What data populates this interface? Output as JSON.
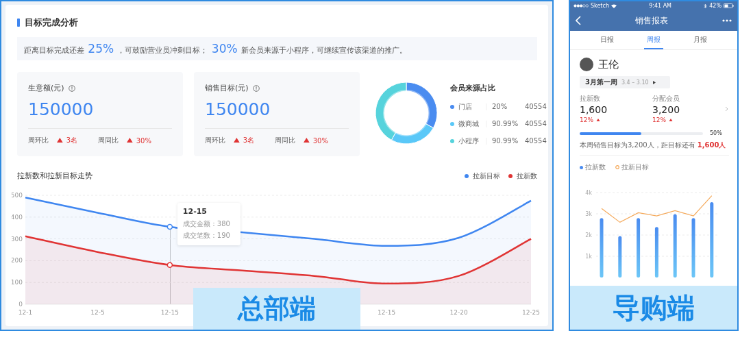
{
  "dashboard": {
    "title": "目标完成分析",
    "summary": "距离目标完成还差 **25%** ，可鼓励营业员冲刺目标； **30%** 新会员来源于小程序，可继续宣传该渠道的推广。",
    "metrics": [
      {
        "label": "生意额(元)",
        "value": "150000",
        "comparisons": [
          {
            "label": "周环比",
            "change": "3名"
          },
          {
            "label": "周同比",
            "change": "30%"
          }
        ]
      },
      {
        "label": "销售目标(元)",
        "value": "150000",
        "comparisons": [
          {
            "label": "周环比",
            "change": "3名"
          },
          {
            "label": "周同比",
            "change": "30%"
          }
        ]
      }
    ],
    "member_sources": {
      "title": "会员来源占比",
      "items": [
        {
          "name": "门店",
          "percent": "20%",
          "count": "40554",
          "color": "#4a8cf0"
        },
        {
          "name": "微商城",
          "percent": "90.99%",
          "count": "40554",
          "color": "#5ac8f8"
        },
        {
          "name": "小程序",
          "percent": "90.99%",
          "count": "40554",
          "color": "#56d3dc"
        }
      ]
    },
    "trend": {
      "title": "拉新数和拉新目标走势",
      "tooltip": {
        "title": "12-15",
        "lines": [
          "成交金额：380",
          "成交笔数：190"
        ]
      },
      "chart_data": {
        "type": "area",
        "grid": true,
        "categories": [
          "12-1",
          "12-5",
          "12-15",
          null,
          null,
          "12-15",
          "12-20",
          "12-25"
        ],
        "ylim": [
          0,
          500
        ],
        "yticks": [
          0,
          100,
          200,
          300,
          400,
          500
        ],
        "series": [
          {
            "name": "拉新目标",
            "color": "#3f86f0",
            "values": [
              490,
              420,
              355,
              330,
              300,
              268,
              305,
              475
            ]
          },
          {
            "name": "拉新数",
            "color": "#e03434",
            "values": [
              312,
              240,
              180,
              155,
              130,
              95,
              130,
              300
            ]
          }
        ]
      }
    },
    "badge": "总部端"
  },
  "phone": {
    "status_bar": {
      "carrier": "Sketch",
      "time": "9:41 AM",
      "battery": "42%"
    },
    "nav_title": "销售报表",
    "tabs": [
      {
        "label": "日报",
        "selected": false
      },
      {
        "label": "周报",
        "selected": true
      },
      {
        "label": "月报",
        "selected": false
      }
    ],
    "user_name": "王伦",
    "period": {
      "label": "3月第一周",
      "range": "3.4 – 3.10"
    },
    "stats": [
      {
        "label": "拉新数",
        "value": "1,600",
        "change": "12%"
      },
      {
        "label": "分配会员",
        "value": "3,200",
        "change": "12%"
      }
    ],
    "progress": {
      "level": 0.5,
      "reading": "50%"
    },
    "target_note": "本周销售目标为3,200人，距目标还有 **1,600人**",
    "chart_data": {
      "type": "bar",
      "grid": true,
      "ylim": [
        0,
        4000
      ],
      "yticks": [
        {
          "value": 1000,
          "label": "1k"
        },
        {
          "value": 2000,
          "label": "2k"
        },
        {
          "value": 3000,
          "label": "3k"
        },
        {
          "value": 4000,
          "label": "4k"
        }
      ],
      "series": [
        {
          "name": "拉新数",
          "type": "bar",
          "color": "#4a8cf0",
          "values": [
            2800,
            1950,
            2800,
            2380,
            2980,
            2800,
            3550
          ]
        },
        {
          "name": "拉新目标",
          "type": "line",
          "color": "#f5a95a",
          "values": [
            3250,
            2600,
            3050,
            2900,
            3150,
            2900,
            3850
          ]
        }
      ]
    },
    "badge": "导购端"
  }
}
